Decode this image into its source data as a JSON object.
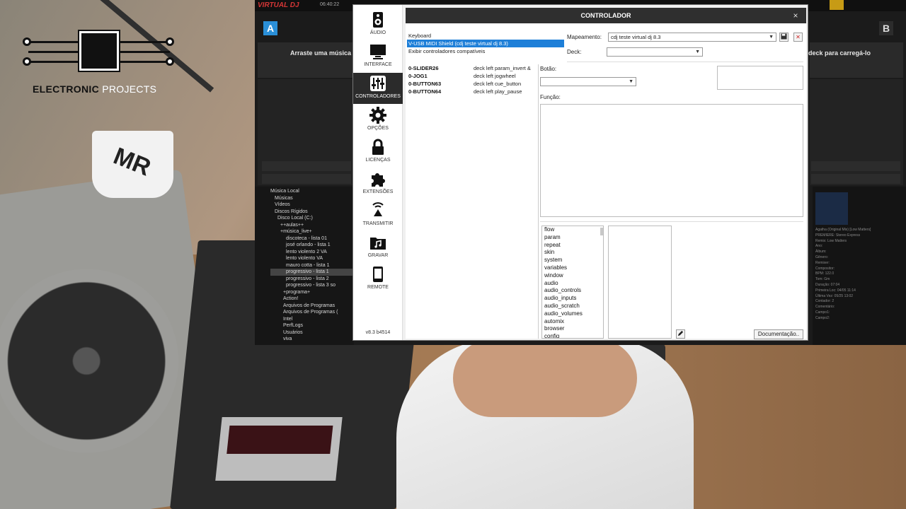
{
  "logo": {
    "text_bold": "ELECTRONIC",
    "text_light": "PROJECTS"
  },
  "virtualdj": {
    "app_logo": "VIRTUAL DJ",
    "clock": "06:40:22",
    "deck_a": "A",
    "deck_b": "B",
    "deck_a_message": "Arraste uma música",
    "deck_b_message": "deck para carregá-lo",
    "browser_tree": [
      "Música Local",
      "Músicas",
      "Vídeos",
      "Discos Rígidos",
      "Disco Local (C:)",
      "++aulas++",
      "+música_live+",
      "discoteca - lista 01",
      "josé orlando - lista 1",
      "lento violento 2 VA",
      "lento violento VA",
      "mauro cotta - lista 1",
      "progressivo - lista 1",
      "progressivo - lista 2",
      "progressivo - lista 3 so",
      "+programa+",
      "Action!",
      "Arquivos de Programas",
      "Arquivos de Programas (",
      "Intel",
      "PerfLogs",
      "Usuários",
      "viva"
    ],
    "info_lines": [
      "Agatha (Original Mix) [Low Matters]",
      "PREMIERE: Stereo Express",
      "Remix: Low Matters",
      "Ano:",
      "Álbum:",
      "Gênero:",
      "Remixer:",
      "Compositor:",
      "BPM: 122.0",
      "Tom: Gm",
      "Duração: 07:04",
      "Primeira Loc: 04/05 11:14",
      "Última Vez: 05/25 13:02",
      "Contador: 2",
      "Comentário:",
      "Campo1:",
      "Campo2:"
    ]
  },
  "sidebar": {
    "items": [
      {
        "label": "ÁUDIO",
        "icon": "speaker-icon"
      },
      {
        "label": "INTERFACE",
        "icon": "monitor-icon"
      },
      {
        "label": "CONTROLADORES",
        "icon": "sliders-icon"
      },
      {
        "label": "OPÇÕES",
        "icon": "gear-icon"
      },
      {
        "label": "LICENÇAS",
        "icon": "lock-icon"
      },
      {
        "label": "EXTENSÕES",
        "icon": "puzzle-icon"
      },
      {
        "label": "TRANSMITIR",
        "icon": "broadcast-icon"
      },
      {
        "label": "GRAVAR",
        "icon": "record-folder-icon"
      },
      {
        "label": "REMOTE",
        "icon": "phone-icon"
      }
    ],
    "version": "v8.3 b4514"
  },
  "dialog": {
    "title": "CONTROLADOR",
    "close": "×",
    "controllers": [
      "Keyboard",
      "V-USB MIDI Shield (cdj teste virtual dj 8.3)",
      "Exibir controladores compatíveis"
    ],
    "mapping_label": "Mapeamento:",
    "mapping_value": "cdj teste virtual dj 8.3",
    "deck_label": "Deck:",
    "deck_value": "",
    "button_label": "Botão:",
    "function_label": "Função:",
    "mappings": [
      {
        "key": "0-SLIDER26",
        "action": "deck left param_invert &"
      },
      {
        "key": "0-JOG1",
        "action": "deck left jogwheel"
      },
      {
        "key": "0-BUTTON63",
        "action": "deck left cue_button"
      },
      {
        "key": "0-BUTTON64",
        "action": "deck left play_pause"
      }
    ],
    "verbs": [
      "flow",
      "param",
      "repeat",
      "skin",
      "system",
      "variables",
      "window",
      "audio",
      "audio_controls",
      "audio_inputs",
      "audio_scratch",
      "audio_volumes",
      "automix",
      "browser",
      "config"
    ],
    "doc_button": "Documentação.."
  },
  "colors": {
    "selection": "#1e7fd8",
    "active_nav": "#2b2b2b",
    "vdj_red": "#d43636",
    "deck_a_blue": "#2a8fd8"
  }
}
